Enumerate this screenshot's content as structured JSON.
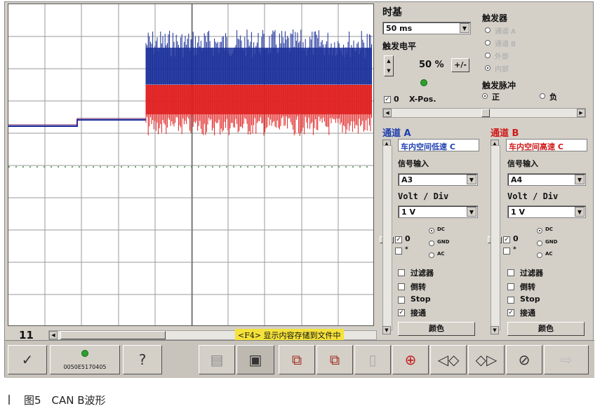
{
  "timebase": {
    "label": "时基",
    "value": "50 ms"
  },
  "trigger": {
    "title": "触发器",
    "options": [
      "通道 A",
      "通道 B",
      "外部",
      "内部"
    ],
    "selected": "内部",
    "level_label": "触发电平",
    "level_value": "50 %",
    "pm_label": "+/-",
    "pulse_label": "触发脉冲",
    "pulse_pos": "正",
    "pulse_neg": "负",
    "pulse_selected": "正",
    "xpos_zero": "0",
    "xpos_label": "X-Pos."
  },
  "channel_a": {
    "title": "通道 A",
    "name": "车内空间低速 C",
    "signal_label": "信号输入",
    "signal_value": "A3",
    "volt_label": "Volt / Div",
    "volt_value": "1 V",
    "zero": "0",
    "coupling": [
      "DC",
      "GND",
      "AC"
    ],
    "coupling_selected": "DC",
    "filter": "过滤器",
    "invert": "倒转",
    "stop": "Stop",
    "connect": "接通",
    "connect_checked": true,
    "color_button": "颜色",
    "color": "#1a2f9a"
  },
  "channel_b": {
    "title": "通道 B",
    "name": "车内空间高速 C",
    "signal_label": "信号输入",
    "signal_value": "A4",
    "volt_label": "Volt / Div",
    "volt_value": "1 V",
    "zero": "0",
    "coupling": [
      "DC",
      "GND",
      "AC"
    ],
    "coupling_selected": "DC",
    "filter": "过滤器",
    "invert": "倒转",
    "stop": "Stop",
    "connect": "接通",
    "connect_checked": true,
    "color_button": "颜色",
    "color": "#e02020"
  },
  "status": {
    "number": "11",
    "hint": "<F4> 显示内容存储到文件中"
  },
  "toolbar": {
    "device_id": "0050E5170405",
    "icons": [
      "checkmark-icon",
      "status-led-icon",
      "help-icon",
      "print-icon",
      "save-icon",
      "copy-icon",
      "paste-icon",
      "blank-icon",
      "zoom-icon",
      "shift-left-icon",
      "shift-right-icon",
      "erase-icon",
      "next-icon"
    ]
  },
  "caption": "图5　CAN B波形"
}
